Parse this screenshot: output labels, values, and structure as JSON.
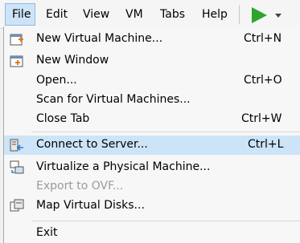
{
  "menubar": {
    "items": [
      {
        "label": "File"
      },
      {
        "label": "Edit"
      },
      {
        "label": "View"
      },
      {
        "label": "VM"
      },
      {
        "label": "Tabs"
      },
      {
        "label": "Help"
      }
    ],
    "play_icon": "play-icon",
    "play_color": "#2da52d"
  },
  "file_menu": {
    "items": [
      {
        "label": "New Virtual Machine...",
        "shortcut": "Ctrl+N",
        "icon": "new-vm-icon"
      },
      {
        "label": "New Window",
        "shortcut": "",
        "icon": "new-window-icon"
      },
      {
        "label": "Open...",
        "shortcut": "Ctrl+O"
      },
      {
        "label": "Scan for Virtual Machines...",
        "shortcut": ""
      },
      {
        "label": "Close Tab",
        "shortcut": "Ctrl+W"
      },
      {
        "label": "Connect to Server...",
        "shortcut": "Ctrl+L",
        "icon": "connect-server-icon",
        "highlighted": true
      },
      {
        "label": "Virtualize a Physical Machine...",
        "shortcut": "",
        "icon": "virtualize-machine-icon"
      },
      {
        "label": "Export to OVF...",
        "shortcut": "",
        "disabled": true
      },
      {
        "label": "Map Virtual Disks...",
        "shortcut": "",
        "icon": "map-disks-icon"
      },
      {
        "label": "Exit",
        "shortcut": ""
      }
    ]
  },
  "colors": {
    "highlight": "#cce4f7",
    "active_menu": "#cde4f8",
    "disabled_text": "#9a9a9a"
  }
}
